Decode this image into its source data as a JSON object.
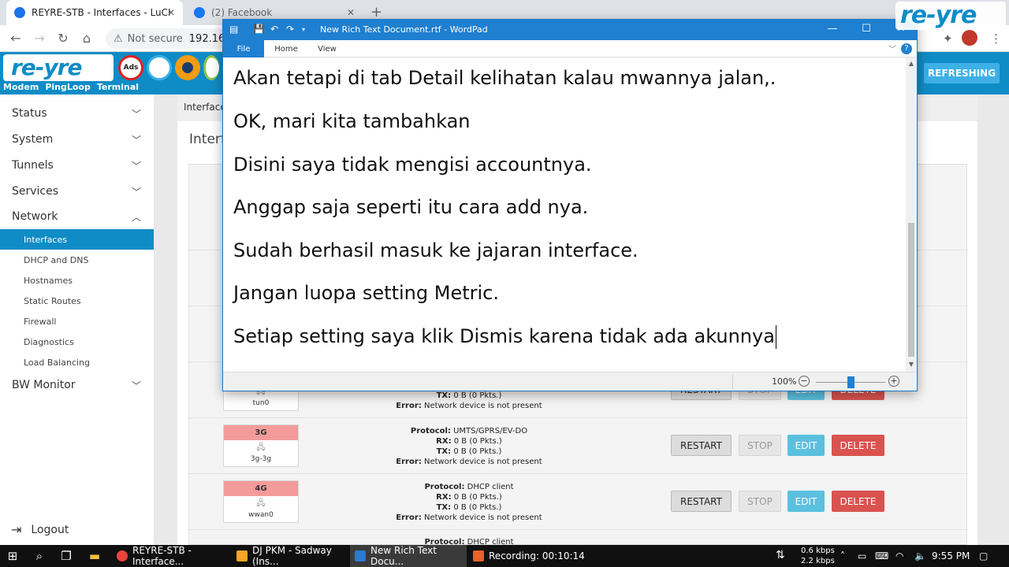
{
  "browser": {
    "tabs": [
      {
        "title": "REYRE-STB - Interfaces - LuCI",
        "active": true
      },
      {
        "title": "(2) Facebook",
        "active": false
      }
    ],
    "address": {
      "security": "Not secure",
      "url": "192.16"
    }
  },
  "header": {
    "logo": "re-yre",
    "links": [
      "Modem",
      "PingLoop",
      "Terminal"
    ],
    "refresh_label": "REFRESHING",
    "icons": [
      "ads-block-icon",
      "speed-icon",
      "openvpn-icon",
      "power-icon"
    ]
  },
  "sidebar": {
    "main_items": [
      {
        "label": "Status",
        "expanded": false
      },
      {
        "label": "System",
        "expanded": false
      },
      {
        "label": "Tunnels",
        "expanded": false
      },
      {
        "label": "Services",
        "expanded": false
      },
      {
        "label": "Network",
        "expanded": true
      },
      {
        "label": "BW Monitor",
        "expanded": false
      }
    ],
    "network_subitems": [
      {
        "label": "Interfaces",
        "active": true
      },
      {
        "label": "DHCP and DNS",
        "active": false
      },
      {
        "label": "Hostnames",
        "active": false
      },
      {
        "label": "Static Routes",
        "active": false
      },
      {
        "label": "Firewall",
        "active": false
      },
      {
        "label": "Diagnostics",
        "active": false
      },
      {
        "label": "Load Balancing",
        "active": false
      }
    ],
    "logout_label": "Logout"
  },
  "content": {
    "breadcrumb": "Interface",
    "heading": "Interf",
    "interfaces": [
      {
        "name": "",
        "device": "tun0",
        "protocol": "",
        "rx": "",
        "tx": "0 B (0 Pkts.)",
        "error": "Network device is not present"
      },
      {
        "name": "3G",
        "device": "3g-3g",
        "protocol": "UMTS/GPRS/EV-DO",
        "rx": "0 B (0 Pkts.)",
        "tx": "0 B (0 Pkts.)",
        "error": "Network device is not present"
      },
      {
        "name": "4G",
        "device": "wwan0",
        "protocol": "DHCP client",
        "rx": "0 B (0 Pkts.)",
        "tx": "0 B (0 Pkts.)",
        "error": "Network device is not present"
      },
      {
        "name": "",
        "device": "",
        "protocol": "DHCP client",
        "rx": "",
        "tx": "",
        "error": ""
      }
    ],
    "labels": {
      "protocol": "Protocol:",
      "rx": "RX:",
      "tx": "TX:",
      "error": "Error:",
      "restart": "RESTART",
      "stop": "STOP",
      "edit": "EDIT",
      "delete": "DELETE"
    }
  },
  "wordpad": {
    "title": "New Rich Text Document.rtf - WordPad",
    "ribbon_tabs": [
      "File",
      "Home",
      "View"
    ],
    "lines": [
      "Akan tetapi di tab Detail kelihatan kalau mwannya jalan,.",
      "OK, mari kita tambahkan",
      "Disini saya tidak mengisi accountnya.",
      "Anggap saja seperti itu cara add nya.",
      "Sudah berhasil masuk ke jajaran interface.",
      "Jangan luopa setting Metric.",
      "Setiap setting saya klik Dismis karena tidak ada akunnya"
    ],
    "zoom": "100%",
    "zoom_level": 0.5
  },
  "taskbar": {
    "items": [
      {
        "label": "REYRE-STB - Interface...",
        "active": false,
        "color": "#e8453c"
      },
      {
        "label": "DJ PKM - Sadway (Ins...",
        "active": false,
        "color": "#f5a623"
      },
      {
        "label": "New Rich Text Docu...",
        "active": true,
        "color": "#2b79d0"
      },
      {
        "label": "Recording:  00:10:14",
        "active": false,
        "color": "#e8622a"
      }
    ],
    "net_up": "0.6 kbps",
    "net_down": "2.2 kbps",
    "time": "9:55 PM"
  },
  "watermark": "re-yre",
  "colors": {
    "accent": "#0f8cc6",
    "wordpad_title": "#1f7fd0",
    "delete": "#d9534f",
    "edit": "#5bc0de",
    "iface_name_bg": "#f39b9b"
  }
}
